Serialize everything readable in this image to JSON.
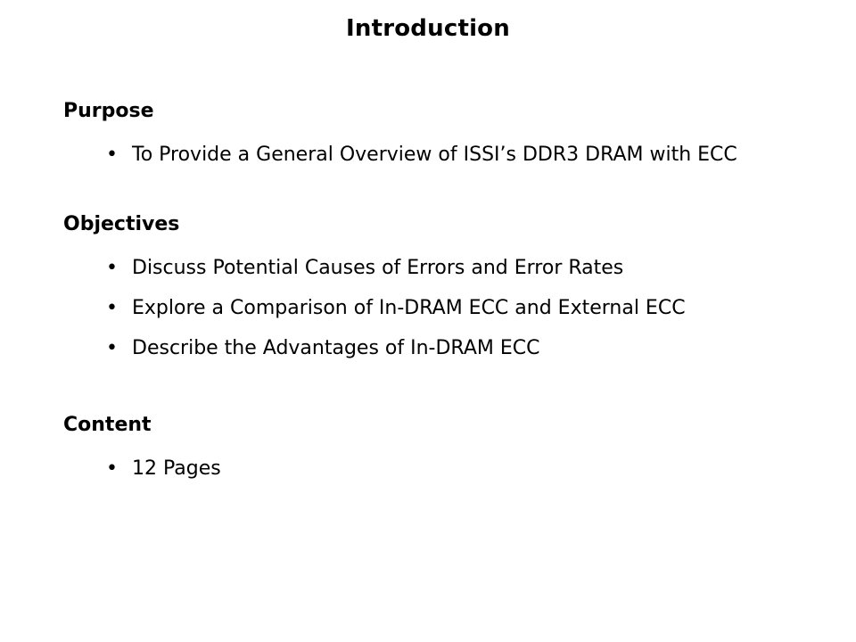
{
  "slide": {
    "title": "Introduction",
    "text_color": "#000000",
    "background_color": "#ffffff",
    "sections": [
      {
        "heading": "Purpose",
        "bullets": [
          {
            "marker": "•",
            "text": "To Provide a General Overview of ISSI’s DDR3 DRAM with ECC"
          }
        ]
      },
      {
        "heading": "Objectives",
        "bullets": [
          {
            "marker": "•",
            "text": "Discuss Potential Causes of Errors and Error Rates"
          },
          {
            "marker": "•",
            "text": "Explore a Comparison of In-DRAM ECC and External ECC"
          },
          {
            "marker": "•",
            "text": "Describe the Advantages of In-DRAM ECC"
          }
        ]
      },
      {
        "heading": "Content",
        "bullets": [
          {
            "marker": "•",
            "text": "12 Pages"
          }
        ]
      }
    ]
  }
}
